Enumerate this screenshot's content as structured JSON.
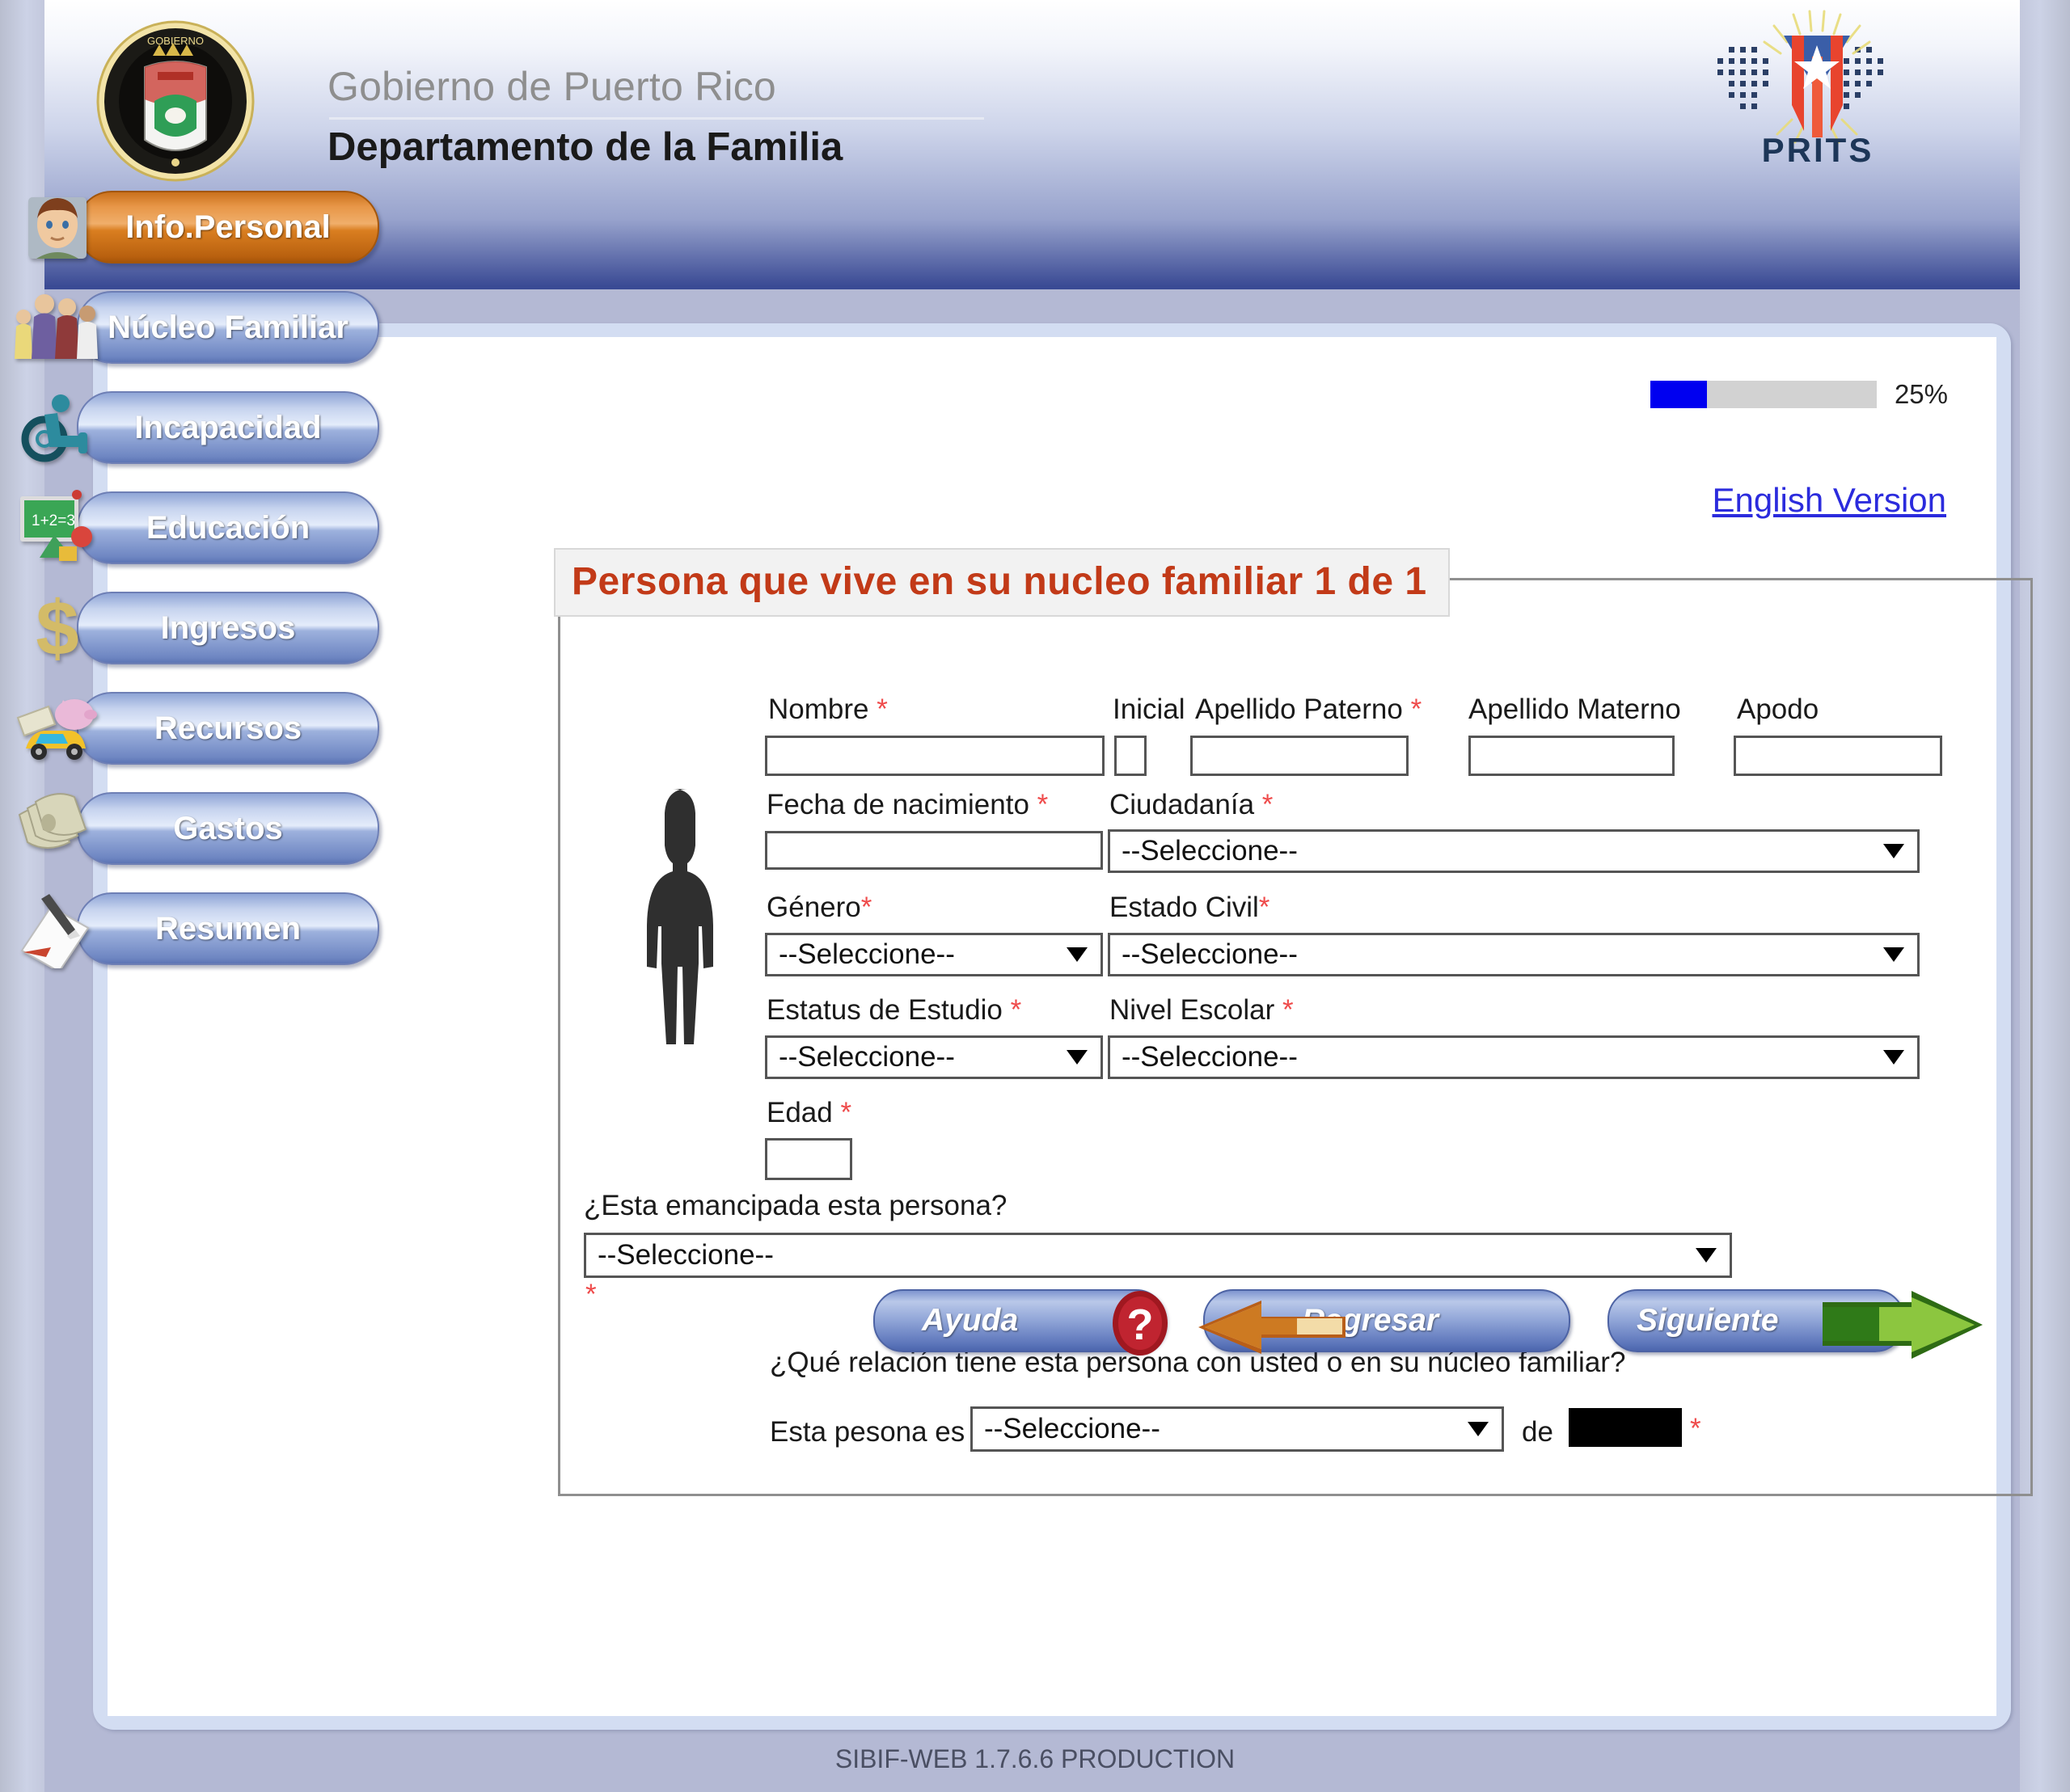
{
  "header": {
    "gov_line": "Gobierno de Puerto Rico",
    "dept_line": "Departamento de la Familia",
    "seal_icon": "puerto-rico-government-seal",
    "prits_logo_label": "PRITS",
    "prits_icon": "prits-puerto-rico-flag-logo"
  },
  "progress": {
    "percent_label": "25%",
    "percent_value": 25,
    "fill_color": "#0000f0",
    "track_color": "#d2d2d2"
  },
  "language_link": {
    "label": "English Version"
  },
  "sidebar": {
    "items": [
      {
        "label": "Info.Personal",
        "icon": "person-avatar-icon",
        "active": true
      },
      {
        "label": "Núcleo Familiar",
        "icon": "family-group-icon",
        "active": false
      },
      {
        "label": "Incapacidad",
        "icon": "wheelchair-icon",
        "active": false
      },
      {
        "label": "Educación",
        "icon": "chalkboard-icon",
        "active": false
      },
      {
        "label": "Ingresos",
        "icon": "dollar-sign-icon",
        "active": false
      },
      {
        "label": "Recursos",
        "icon": "piggybank-car-icon",
        "active": false
      },
      {
        "label": "Gastos",
        "icon": "cash-bills-icon",
        "active": false
      },
      {
        "label": "Resumen",
        "icon": "notepad-pen-icon",
        "active": false
      }
    ]
  },
  "form": {
    "legend": "Persona que vive en su nucleo familiar 1  de 1",
    "person_silhouette_icon": "person-silhouette-icon",
    "select_placeholder": "--Seleccione--",
    "required_mark": "*",
    "fields": {
      "nombre": {
        "label": "Nombre",
        "value": "",
        "required": true
      },
      "inicial": {
        "label": "Inicial",
        "value": "",
        "required": false
      },
      "apellido_paterno": {
        "label": "Apellido Paterno",
        "value": "",
        "required": true
      },
      "apellido_materno": {
        "label": "Apellido Materno",
        "value": "",
        "required": false
      },
      "apodo": {
        "label": "Apodo",
        "value": "",
        "required": false
      },
      "fecha_nacimiento": {
        "label": "Fecha de nacimiento",
        "value": "",
        "required": true
      },
      "ciudadania": {
        "label": "Ciudadanía",
        "value": "--Seleccione--",
        "required": true
      },
      "genero": {
        "label": "Género",
        "value": "--Seleccione--",
        "required": true
      },
      "estado_civil": {
        "label": "Estado Civil",
        "value": "--Seleccione--",
        "required": true
      },
      "estatus_estudio": {
        "label": "Estatus de Estudio",
        "value": "--Seleccione--",
        "required": true
      },
      "nivel_escolar": {
        "label": "Nivel Escolar",
        "value": "--Seleccione--",
        "required": true
      },
      "edad": {
        "label": "Edad",
        "value": "",
        "required": true
      },
      "emancipada": {
        "label": "¿Esta emancipada esta persona?",
        "value": "--Seleccione--",
        "required": true
      }
    },
    "relation": {
      "question": "¿Qué relación tiene esta persona con usted o en su núcleo familiar?",
      "prefix": "Esta pesona es",
      "select_value": "--Seleccione--",
      "middle_word": "de",
      "redacted_value": ""
    }
  },
  "buttons": {
    "ayuda": {
      "label": "Ayuda",
      "icon": "question-mark-icon"
    },
    "regresar": {
      "label": "Regresar",
      "icon": "arrow-left-icon"
    },
    "siguiente": {
      "label": "Siguiente",
      "icon": "arrow-right-icon"
    }
  },
  "footer": {
    "version_text": "SIBIF-WEB 1.7.6.6 PRODUCTION"
  }
}
